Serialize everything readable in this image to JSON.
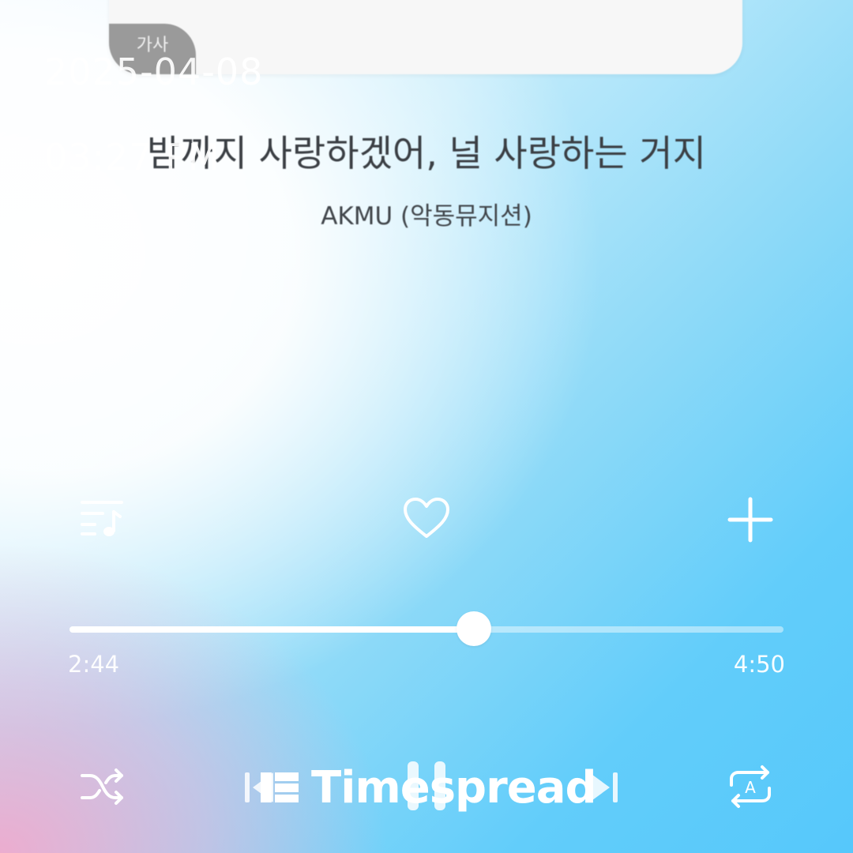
{
  "lyrics_card": {
    "tag_label": "가사"
  },
  "overlay": {
    "date": "2025-04-08",
    "time": "03:27 PM"
  },
  "song": {
    "title": "밤까지 사랑하겠어, 널 사랑하는 거지",
    "artist": "AKMU (악동뮤지션)"
  },
  "actions": {
    "playlist_icon": "playlist-icon",
    "like_icon": "heart-icon",
    "add_icon": "plus-icon"
  },
  "progress": {
    "elapsed": "2:44",
    "total": "4:50",
    "fraction": 0.566
  },
  "controls": {
    "shuffle_icon": "shuffle-icon",
    "prev_icon": "previous-icon",
    "play_state": "pause-icon",
    "next_icon": "next-icon",
    "repeat_icon": "repeat-icon"
  },
  "watermark": {
    "text": "Timespread"
  },
  "colors": {
    "accent_white": "#ffffff",
    "text_dark": "#3b3f44",
    "bg_blue": "#56c8fb",
    "bg_pink": "#f0aacd"
  }
}
